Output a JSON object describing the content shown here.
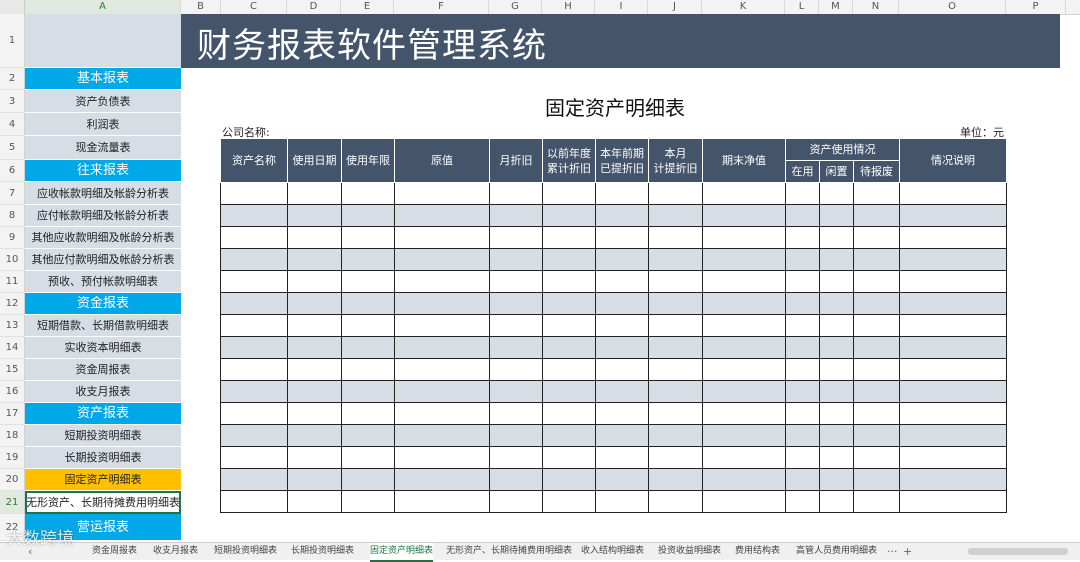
{
  "columns": [
    "A",
    "B",
    "C",
    "D",
    "E",
    "F",
    "G",
    "H",
    "I",
    "J",
    "K",
    "L",
    "M",
    "N",
    "O",
    "P"
  ],
  "active_column": "A",
  "banner_title": "财务报表软件管理系统",
  "sidebar": [
    {
      "row": "1",
      "label": "",
      "kind": "blank"
    },
    {
      "row": "2",
      "label": "基本报表",
      "kind": "cat"
    },
    {
      "row": "3",
      "label": "资产负债表",
      "kind": "item"
    },
    {
      "row": "4",
      "label": "利润表",
      "kind": "item"
    },
    {
      "row": "5",
      "label": "现金流量表",
      "kind": "item"
    },
    {
      "row": "6",
      "label": "往来报表",
      "kind": "cat"
    },
    {
      "row": "7",
      "label": "应收帐款明细及帐龄分析表",
      "kind": "item"
    },
    {
      "row": "8",
      "label": "应付帐款明细及帐龄分析表",
      "kind": "item"
    },
    {
      "row": "9",
      "label": "其他应收款明细及帐龄分析表",
      "kind": "item"
    },
    {
      "row": "10",
      "label": "其他应付款明细及帐龄分析表",
      "kind": "item"
    },
    {
      "row": "11",
      "label": "预收、预付帐款明细表",
      "kind": "item"
    },
    {
      "row": "12",
      "label": "资金报表",
      "kind": "cat"
    },
    {
      "row": "13",
      "label": "短期借款、长期借款明细表",
      "kind": "item"
    },
    {
      "row": "14",
      "label": "实收资本明细表",
      "kind": "item"
    },
    {
      "row": "15",
      "label": "资金周报表",
      "kind": "item"
    },
    {
      "row": "16",
      "label": "收支月报表",
      "kind": "item"
    },
    {
      "row": "17",
      "label": "资产报表",
      "kind": "cat"
    },
    {
      "row": "18",
      "label": "短期投资明细表",
      "kind": "item"
    },
    {
      "row": "19",
      "label": "长期投资明细表",
      "kind": "item"
    },
    {
      "row": "20",
      "label": "固定资产明细表",
      "kind": "hl"
    },
    {
      "row": "21",
      "label": "无形资产、长期待摊费用明细表",
      "kind": "sel"
    },
    {
      "row": "22",
      "label": "营运报表",
      "kind": "cat"
    }
  ],
  "report": {
    "title": "固定资产明细表",
    "company_label": "公司名称:",
    "unit_label": "单位：元",
    "headers": {
      "asset_name": "资产名称",
      "use_date": "使用日期",
      "use_years": "使用年限",
      "original_value": "原值",
      "monthly_dep": "月折旧",
      "prior_years_dep_1": "以前年度",
      "prior_years_dep_2": "累计折旧",
      "ytd_dep_1": "本年前期",
      "ytd_dep_2": "已提折旧",
      "month_dep_1": "本月",
      "month_dep_2": "计提折旧",
      "net_value": "期末净值",
      "usage_group": "资产使用情况",
      "in_use": "在用",
      "idle": "闲置",
      "pending_scrap": "待报废",
      "remarks": "情况说明"
    }
  },
  "sheet_tabs": [
    "资金周报表",
    "收支月报表",
    "短期投资明细表",
    "长期投资明细表",
    "固定资产明细表",
    "无形资产、长期待摊费用明细表",
    "收入结构明细表",
    "投资收益明细表",
    "费用结构表",
    "高管人员费用明细表"
  ],
  "active_tab": "固定资产明细表",
  "tab_more": "···",
  "tab_add": "+",
  "watermark": "大数跨境"
}
